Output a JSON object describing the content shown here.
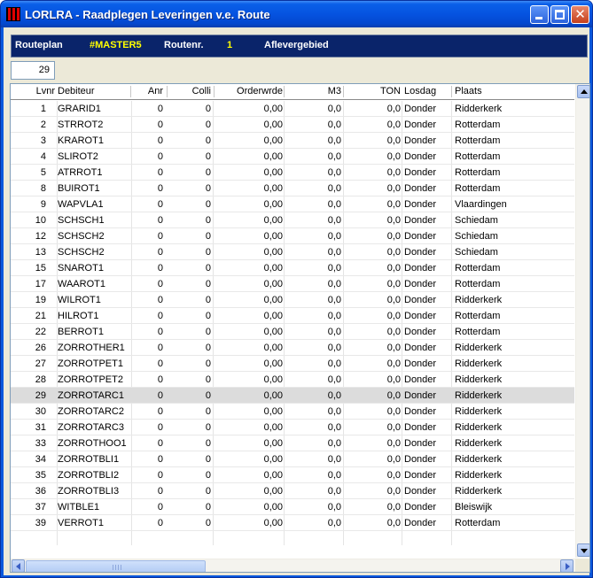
{
  "window": {
    "title": "LORLRA - Raadplegen Leveringen v.e. Route",
    "controls": [
      "minimize-icon",
      "maximize-icon",
      "close-icon"
    ],
    "close_glyph": "✕"
  },
  "header": {
    "routeplan_label": "Routeplan",
    "routeplan_value": "#MASTER5",
    "routenr_label": "Routenr.",
    "routenr_value": "1",
    "aflevergebied_label": "Aflevergebied"
  },
  "record_count": "29",
  "table": {
    "columns": [
      "Lvnr",
      "Debiteur",
      "Anr",
      "Colli",
      "Orderwrde",
      "M3",
      "TON",
      "Losdag",
      "Plaats"
    ],
    "selected_row_index": 18,
    "rows": [
      [
        "1",
        "GRARID1",
        "0",
        "0",
        "0,00",
        "0,0",
        "0,0",
        "Donder",
        "Ridderkerk"
      ],
      [
        "2",
        "STRROT2",
        "0",
        "0",
        "0,00",
        "0,0",
        "0,0",
        "Donder",
        "Rotterdam"
      ],
      [
        "3",
        "KRAROT1",
        "0",
        "0",
        "0,00",
        "0,0",
        "0,0",
        "Donder",
        "Rotterdam"
      ],
      [
        "4",
        "SLIROT2",
        "0",
        "0",
        "0,00",
        "0,0",
        "0,0",
        "Donder",
        "Rotterdam"
      ],
      [
        "5",
        "ATRROT1",
        "0",
        "0",
        "0,00",
        "0,0",
        "0,0",
        "Donder",
        "Rotterdam"
      ],
      [
        "8",
        "BUIROT1",
        "0",
        "0",
        "0,00",
        "0,0",
        "0,0",
        "Donder",
        "Rotterdam"
      ],
      [
        "9",
        "WAPVLA1",
        "0",
        "0",
        "0,00",
        "0,0",
        "0,0",
        "Donder",
        "Vlaardingen"
      ],
      [
        "10",
        "SCHSCH1",
        "0",
        "0",
        "0,00",
        "0,0",
        "0,0",
        "Donder",
        "Schiedam"
      ],
      [
        "12",
        "SCHSCH2",
        "0",
        "0",
        "0,00",
        "0,0",
        "0,0",
        "Donder",
        "Schiedam"
      ],
      [
        "13",
        "SCHSCH2",
        "0",
        "0",
        "0,00",
        "0,0",
        "0,0",
        "Donder",
        "Schiedam"
      ],
      [
        "15",
        "SNAROT1",
        "0",
        "0",
        "0,00",
        "0,0",
        "0,0",
        "Donder",
        "Rotterdam"
      ],
      [
        "17",
        "WAAROT1",
        "0",
        "0",
        "0,00",
        "0,0",
        "0,0",
        "Donder",
        "Rotterdam"
      ],
      [
        "19",
        "WILROT1",
        "0",
        "0",
        "0,00",
        "0,0",
        "0,0",
        "Donder",
        "Ridderkerk"
      ],
      [
        "21",
        "HILROT1",
        "0",
        "0",
        "0,00",
        "0,0",
        "0,0",
        "Donder",
        "Rotterdam"
      ],
      [
        "22",
        "BERROT1",
        "0",
        "0",
        "0,00",
        "0,0",
        "0,0",
        "Donder",
        "Rotterdam"
      ],
      [
        "26",
        "ZORROTHER1",
        "0",
        "0",
        "0,00",
        "0,0",
        "0,0",
        "Donder",
        "Ridderkerk"
      ],
      [
        "27",
        "ZORROTPET1",
        "0",
        "0",
        "0,00",
        "0,0",
        "0,0",
        "Donder",
        "Ridderkerk"
      ],
      [
        "28",
        "ZORROTPET2",
        "0",
        "0",
        "0,00",
        "0,0",
        "0,0",
        "Donder",
        "Ridderkerk"
      ],
      [
        "29",
        "ZORROTARC1",
        "0",
        "0",
        "0,00",
        "0,0",
        "0,0",
        "Donder",
        "Ridderkerk"
      ],
      [
        "30",
        "ZORROTARC2",
        "0",
        "0",
        "0,00",
        "0,0",
        "0,0",
        "Donder",
        "Ridderkerk"
      ],
      [
        "31",
        "ZORROTARC3",
        "0",
        "0",
        "0,00",
        "0,0",
        "0,0",
        "Donder",
        "Ridderkerk"
      ],
      [
        "33",
        "ZORROTHOO1",
        "0",
        "0",
        "0,00",
        "0,0",
        "0,0",
        "Donder",
        "Ridderkerk"
      ],
      [
        "34",
        "ZORROTBLI1",
        "0",
        "0",
        "0,00",
        "0,0",
        "0,0",
        "Donder",
        "Ridderkerk"
      ],
      [
        "35",
        "ZORROTBLI2",
        "0",
        "0",
        "0,00",
        "0,0",
        "0,0",
        "Donder",
        "Ridderkerk"
      ],
      [
        "36",
        "ZORROTBLI3",
        "0",
        "0",
        "0,00",
        "0,0",
        "0,0",
        "Donder",
        "Ridderkerk"
      ],
      [
        "37",
        "WITBLE1",
        "0",
        "0",
        "0,00",
        "0,0",
        "0,0",
        "Donder",
        "Bleiswijk"
      ],
      [
        "39",
        "VERROT1",
        "0",
        "0",
        "0,00",
        "0,0",
        "0,0",
        "Donder",
        "Rotterdam"
      ]
    ]
  },
  "colors": {
    "title_bar": "#0553e0",
    "header_band": "#0a246a",
    "header_highlight": "#ffff00",
    "selected_row": "#dcdcdc",
    "client_bg": "#ece9d8"
  }
}
